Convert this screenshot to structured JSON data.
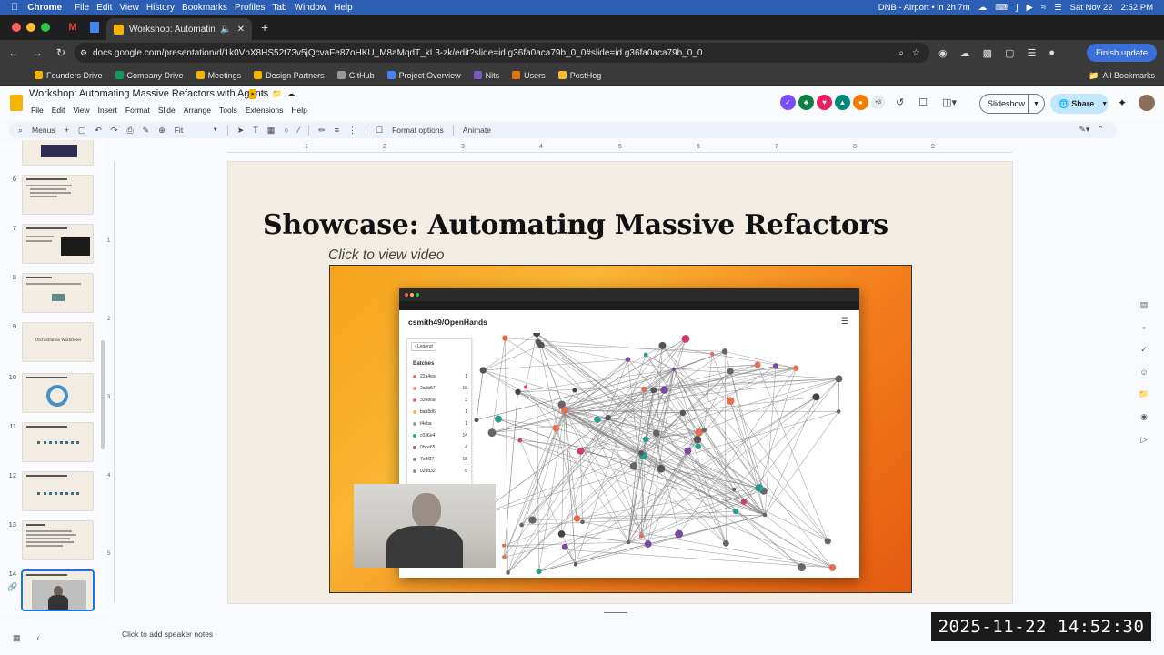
{
  "menubar": {
    "app": "Chrome",
    "items": [
      "File",
      "Edit",
      "View",
      "History",
      "Bookmarks",
      "Profiles",
      "Tab",
      "Window",
      "Help"
    ],
    "status": "DNB - Airport • in 2h 7m",
    "date": "Sat Nov 22",
    "time": "2:52 PM"
  },
  "tabs": [
    {
      "title": "Workshop: Automating M..."
    }
  ],
  "address": {
    "url": "docs.google.com/presentation/d/1k0VbX8HS52t73v5jQcvaFe87oHKU_M8aMqdT_kL3-zk/edit?slide=id.g36fa0aca79b_0_0#slide=id.g36fa0aca79b_0_0",
    "finish_update": "Finish update"
  },
  "bookmarks": {
    "items": [
      {
        "label": "Founders Drive",
        "color": "#f4b400"
      },
      {
        "label": "Company Drive",
        "color": "#0f9d58"
      },
      {
        "label": "Meetings",
        "color": "#f4b400"
      },
      {
        "label": "Design Partners",
        "color": "#f4b400"
      },
      {
        "label": "GitHub",
        "color": "#999999"
      },
      {
        "label": "Project Overview",
        "color": "#4285f4"
      },
      {
        "label": "Nits",
        "color": "#7e57c2"
      },
      {
        "label": "Users",
        "color": "#e37400"
      },
      {
        "label": "PostHog",
        "color": "#f9bd2b"
      }
    ],
    "all": "All Bookmarks"
  },
  "doc": {
    "title": "Workshop: Automating Massive Refactors with Agents",
    "menus": [
      "File",
      "Edit",
      "View",
      "Insert",
      "Format",
      "Slide",
      "Arrange",
      "Tools",
      "Extensions",
      "Help"
    ],
    "avatars": [
      {
        "color": "#7c4dff",
        "glyph": "✓"
      },
      {
        "color": "#0b8043",
        "glyph": "♣"
      },
      {
        "color": "#e91e63",
        "glyph": "♥"
      },
      {
        "color": "#00897b",
        "glyph": "▲"
      },
      {
        "color": "#f57c00",
        "glyph": "●"
      }
    ],
    "avatar_more": "+3",
    "slideshow": "Slideshow",
    "share": "Share"
  },
  "toolbar": {
    "menus": "Menus",
    "zoom": "Fit",
    "format_options": "Format options",
    "animate": "Animate"
  },
  "ruler": {
    "h": [
      "1",
      "2",
      "3",
      "4",
      "5",
      "6",
      "7",
      "8",
      "9"
    ],
    "v": [
      "1",
      "2",
      "3",
      "4",
      "5"
    ]
  },
  "thumbnails": [
    {
      "num": "6",
      "text": ""
    },
    {
      "num": "7",
      "text": ""
    },
    {
      "num": "8",
      "text": ""
    },
    {
      "num": "9",
      "text": "Orchestration Workflows"
    },
    {
      "num": "10",
      "text": ""
    },
    {
      "num": "11",
      "text": ""
    },
    {
      "num": "12",
      "text": ""
    },
    {
      "num": "13",
      "text": ""
    },
    {
      "num": "14",
      "text": ""
    }
  ],
  "slide": {
    "title": "Showcase: Automating Massive Refactors",
    "video_label": "Click to view video",
    "video": {
      "repo": "csmith49/OpenHands",
      "legend_button": "Legend",
      "legend_title": "Batches",
      "batches": [
        {
          "id": "22a4ea",
          "count": "1",
          "color": "#e57373"
        },
        {
          "id": "2a5b57",
          "count": "18",
          "color": "#ff8a65"
        },
        {
          "id": "33986a",
          "count": "3",
          "color": "#f06292"
        },
        {
          "id": "bab8d6",
          "count": "1",
          "color": "#ffb74d"
        },
        {
          "id": "f4eba",
          "count": "1",
          "color": "#9e9e9e"
        },
        {
          "id": "c036e4",
          "count": "14",
          "color": "#26a69a"
        },
        {
          "id": "0bce65",
          "count": "4",
          "color": "#8d6e63"
        },
        {
          "id": "7e8f37",
          "count": "18",
          "color": "#78909c"
        },
        {
          "id": "02bd32",
          "count": "8",
          "color": "#a1887f"
        }
      ]
    }
  },
  "notes": {
    "placeholder": "Click to add speaker notes"
  },
  "timestamp": "2025-11-22 14:52:30"
}
